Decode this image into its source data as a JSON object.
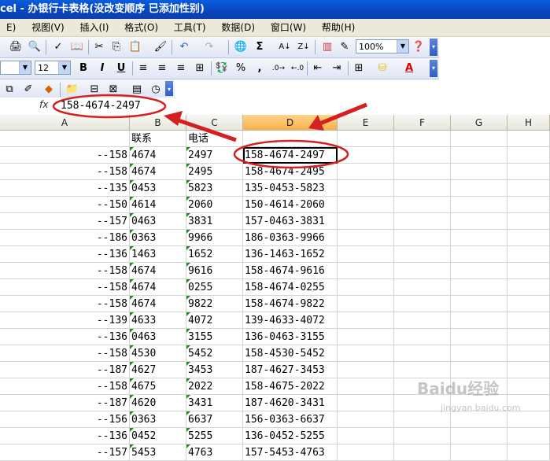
{
  "title": "cel - 办银行卡表格(没改变顺序 已添加性别)",
  "menu": [
    "E)",
    "视图(V)",
    "插入(I)",
    "格式(O)",
    "工具(T)",
    "数据(D)",
    "窗口(W)",
    "帮助(H)"
  ],
  "toolbar": {
    "zoom": "100%",
    "font_size": "12"
  },
  "formula_bar": {
    "fx_label": "fx",
    "value": "158-4674-2497"
  },
  "columns": [
    "A",
    "B",
    "C",
    "D",
    "E",
    "F",
    "G",
    "H"
  ],
  "header_row": {
    "b": "联系",
    "c": "电话"
  },
  "rows": [
    {
      "a": "--158",
      "b": "4674",
      "c": "2497",
      "d": "158-4674-2497"
    },
    {
      "a": "--158",
      "b": "4674",
      "c": "2495",
      "d": "158-4674-2495"
    },
    {
      "a": "--135",
      "b": "0453",
      "c": "5823",
      "d": "135-0453-5823"
    },
    {
      "a": "--150",
      "b": "4614",
      "c": "2060",
      "d": "150-4614-2060"
    },
    {
      "a": "--157",
      "b": "0463",
      "c": "3831",
      "d": "157-0463-3831"
    },
    {
      "a": "--186",
      "b": "0363",
      "c": "9966",
      "d": "186-0363-9966"
    },
    {
      "a": "--136",
      "b": "1463",
      "c": "1652",
      "d": "136-1463-1652"
    },
    {
      "a": "--158",
      "b": "4674",
      "c": "9616",
      "d": "158-4674-9616"
    },
    {
      "a": "--158",
      "b": "4674",
      "c": "0255",
      "d": "158-4674-0255"
    },
    {
      "a": "--158",
      "b": "4674",
      "c": "9822",
      "d": "158-4674-9822"
    },
    {
      "a": "--139",
      "b": "4633",
      "c": "4072",
      "d": "139-4633-4072"
    },
    {
      "a": "--136",
      "b": "0463",
      "c": "3155",
      "d": "136-0463-3155"
    },
    {
      "a": "--158",
      "b": "4530",
      "c": "5452",
      "d": "158-4530-5452"
    },
    {
      "a": "--187",
      "b": "4627",
      "c": "3453",
      "d": "187-4627-3453"
    },
    {
      "a": "--158",
      "b": "4675",
      "c": "2022",
      "d": "158-4675-2022"
    },
    {
      "a": "--187",
      "b": "4620",
      "c": "3431",
      "d": "187-4620-3431"
    },
    {
      "a": "--156",
      "b": "0363",
      "c": "6637",
      "d": "156-0363-6637"
    },
    {
      "a": "--136",
      "b": "0452",
      "c": "5255",
      "d": "136-0452-5255"
    },
    {
      "a": "--157",
      "b": "5453",
      "c": "4763",
      "d": "157-5453-4763"
    }
  ],
  "watermark": {
    "brand": "Baidu经验",
    "url": "jingyan.baidu.com"
  },
  "annotation_color": "#d42020"
}
